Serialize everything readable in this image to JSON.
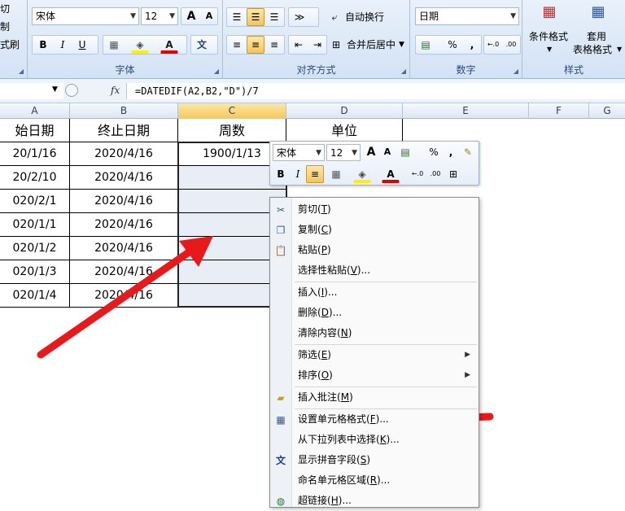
{
  "ribbon": {
    "clipboard": {
      "cut": "切",
      "copy": "制",
      "painter": "式刷"
    },
    "font": {
      "name": "宋体",
      "size": "12",
      "group_label": "字体",
      "bold": "B",
      "italic": "I",
      "underline": "U",
      "grow": "A",
      "shrink": "A",
      "color_letter": "A",
      "phonetic": "文"
    },
    "alignment": {
      "wrap_text": "自动换行",
      "merge_center": "合并后居中",
      "group_label": "对齐方式"
    },
    "number": {
      "format": "日期",
      "percent": "%",
      "comma": ",",
      "group_label": "数字",
      "inc_decimal": "←.0",
      "dec_decimal": ".00"
    },
    "styles": {
      "conditional": "条件格式",
      "table_format_1": "套用",
      "table_format_2": "表格格式",
      "group_label": "样式"
    }
  },
  "formula_bar": {
    "fx": "fx",
    "formula": "=DATEDIF(A2,B2,\"D\")/7"
  },
  "columns": [
    "A",
    "B",
    "C",
    "D",
    "E",
    "F",
    "G"
  ],
  "sheet": {
    "headers": [
      "始日期",
      "终止日期",
      "周数",
      "单位"
    ],
    "rows": [
      {
        "a": "20/1/16",
        "b": "2020/4/16",
        "c": "1900/1/13"
      },
      {
        "a": "20/2/10",
        "b": "2020/4/16",
        "c": ""
      },
      {
        "a": "020/2/1",
        "b": "2020/4/16",
        "c": ""
      },
      {
        "a": "020/1/1",
        "b": "2020/4/16",
        "c": ""
      },
      {
        "a": "020/1/2",
        "b": "2020/4/16",
        "c": ""
      },
      {
        "a": "020/1/3",
        "b": "2020/4/16",
        "c": ""
      },
      {
        "a": "020/1/4",
        "b": "2020/4/16",
        "c": ""
      }
    ]
  },
  "mini_toolbar": {
    "font": "宋体",
    "size": "12",
    "percent": "%",
    "comma": ",",
    "bold": "B",
    "italic": "I",
    "color_letter": "A"
  },
  "context_menu": {
    "items": [
      {
        "label": "剪切",
        "key": "T"
      },
      {
        "label": "复制",
        "key": "C"
      },
      {
        "label": "粘贴",
        "key": "P"
      },
      {
        "label": "选择性粘贴",
        "key": "V",
        "suffix": "..."
      },
      {
        "label": "插入",
        "key": "I",
        "suffix": "..."
      },
      {
        "label": "删除",
        "key": "D",
        "suffix": "..."
      },
      {
        "label": "清除内容",
        "key": "N"
      },
      {
        "label": "筛选",
        "key": "E"
      },
      {
        "label": "排序",
        "key": "O"
      },
      {
        "label": "插入批注",
        "key": "M"
      },
      {
        "label": "设置单元格格式",
        "key": "F",
        "suffix": "..."
      },
      {
        "label": "从下拉列表中选择",
        "key": "K",
        "suffix": "..."
      },
      {
        "label": "显示拼音字段",
        "key": "S"
      },
      {
        "label": "命名单元格区域",
        "key": "R",
        "suffix": "..."
      },
      {
        "label": "超链接",
        "key": "H",
        "suffix": "..."
      }
    ]
  },
  "colors": {
    "arrow": "#e8191b",
    "selection": "#e8edf6",
    "ribbon": "#dbe7f6"
  }
}
